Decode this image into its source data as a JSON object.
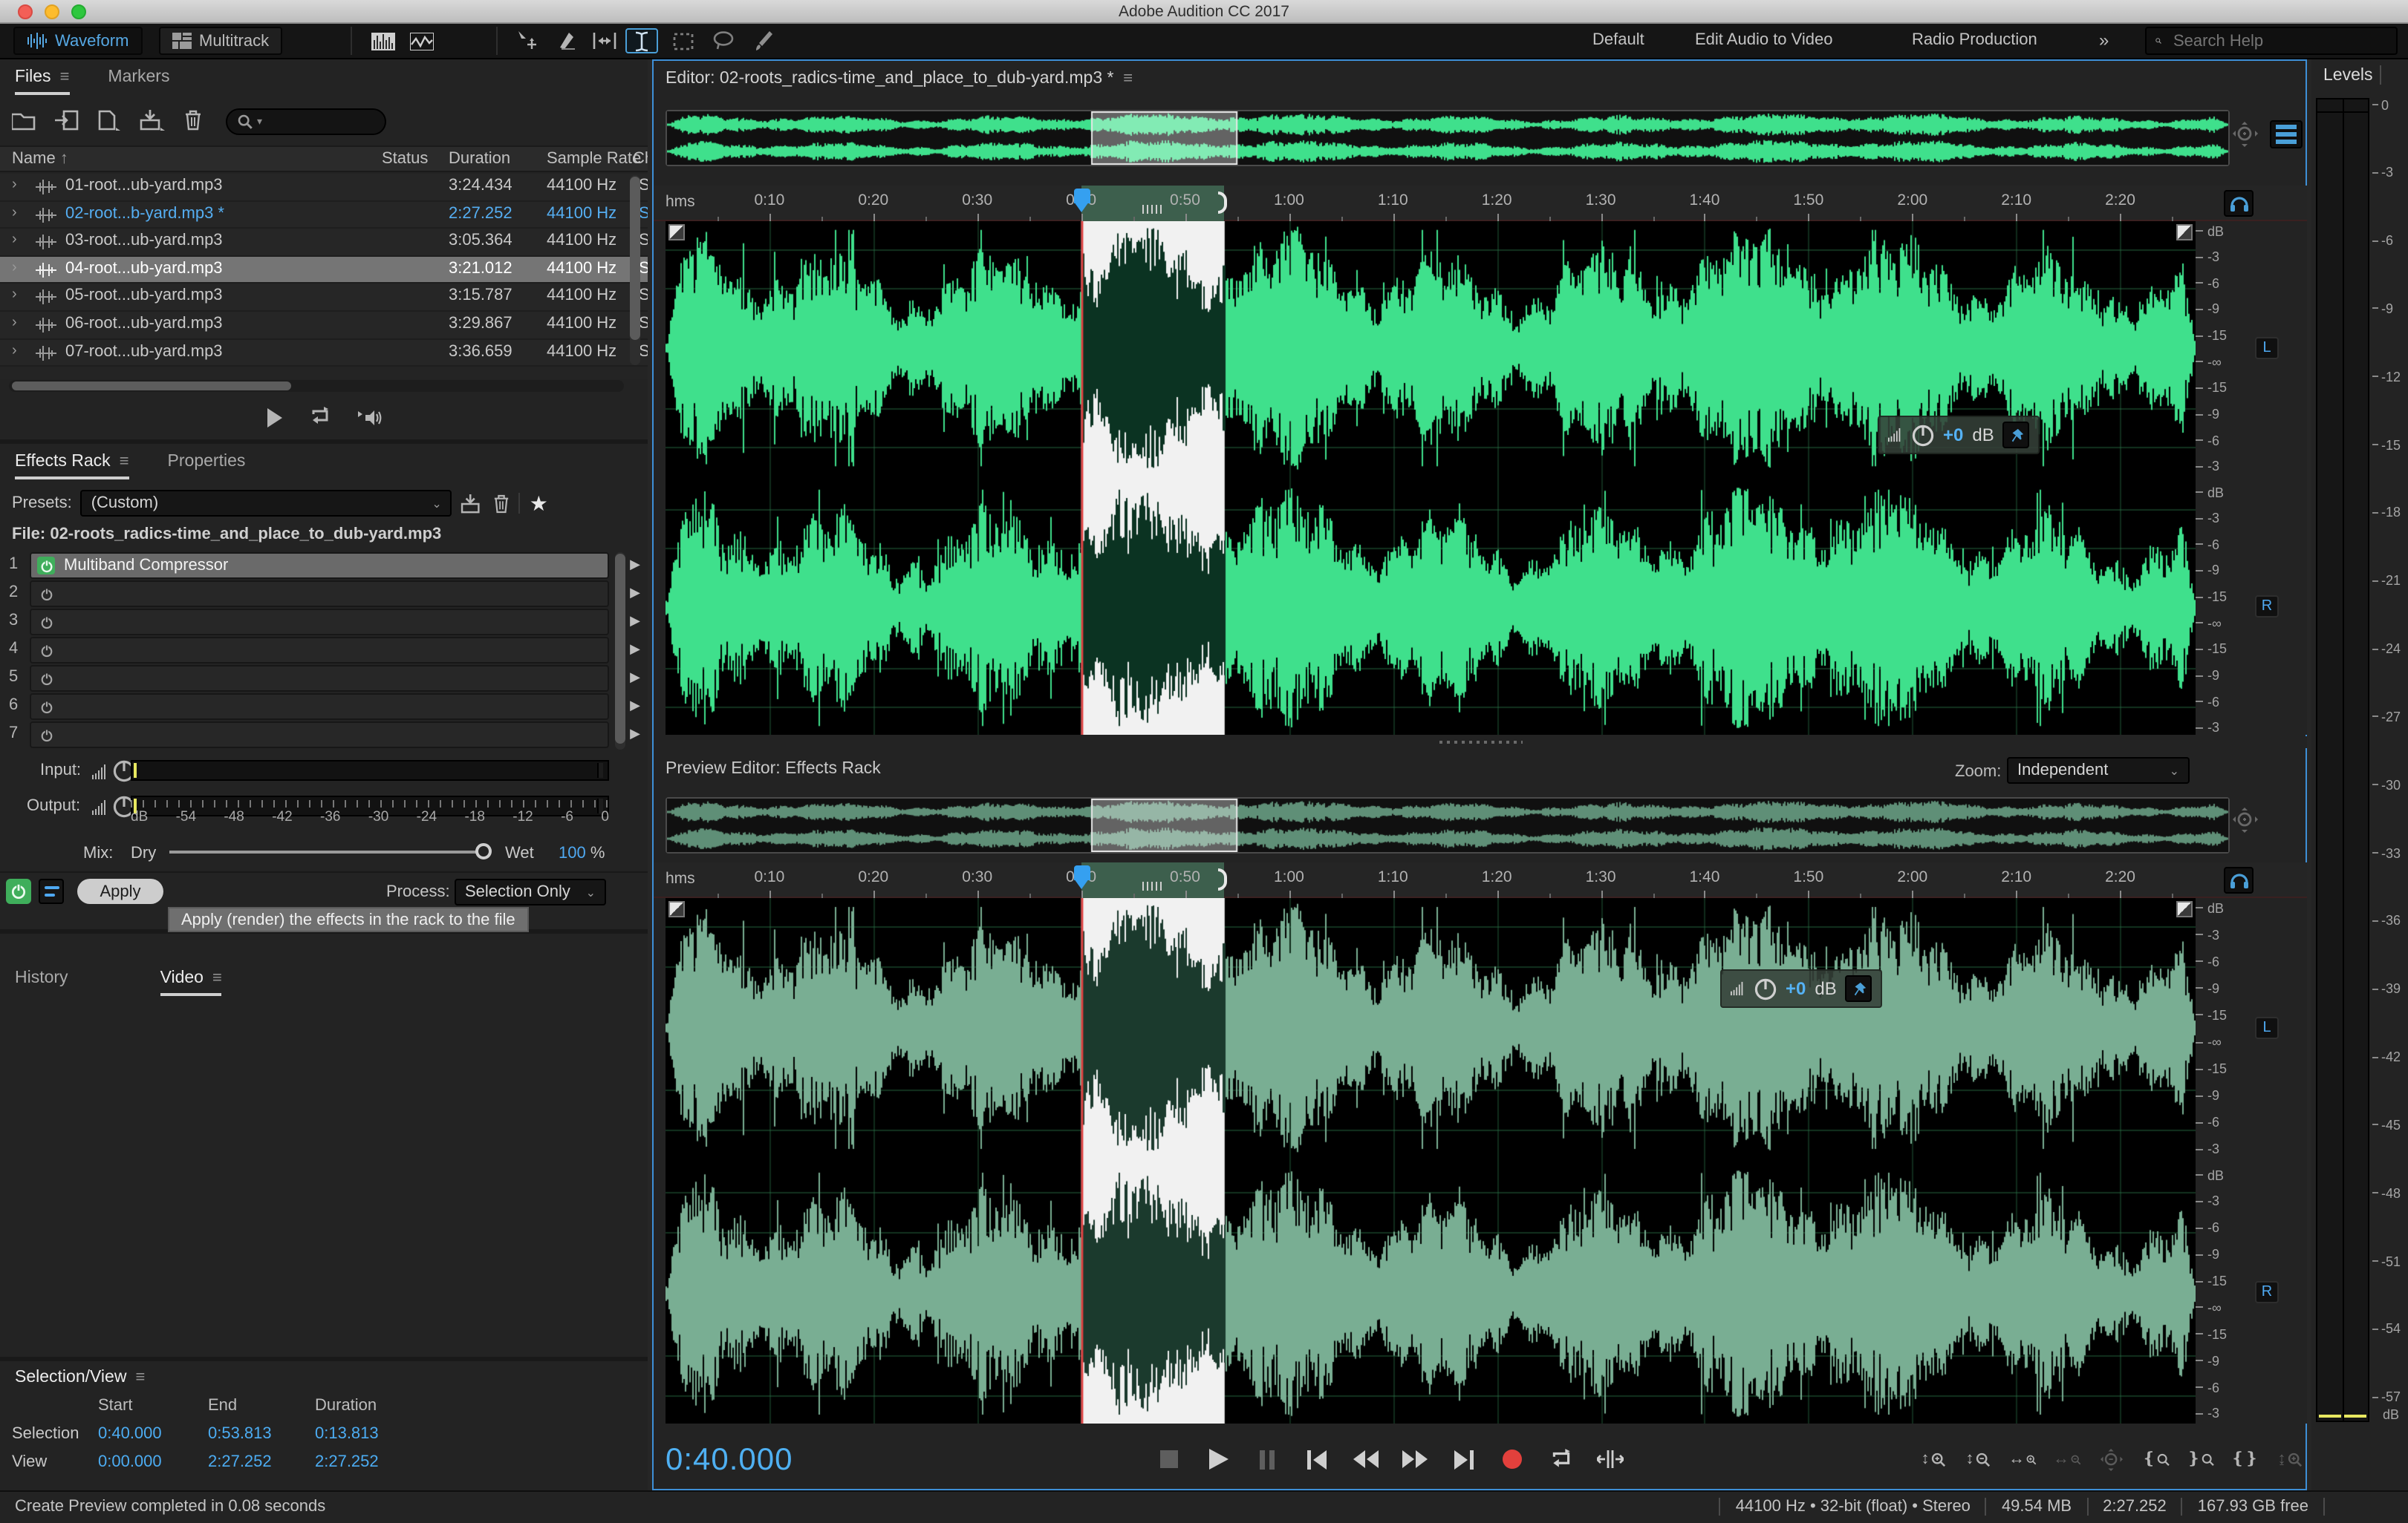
{
  "window": {
    "title": "Adobe Audition CC 2017"
  },
  "toolbar": {
    "waveform_btn": "Waveform",
    "multitrack_btn": "Multitrack",
    "workspaces": [
      "Default",
      "Edit Audio to Video",
      "Radio Production"
    ],
    "more_glyph": "»",
    "search": {
      "placeholder": "Search Help"
    }
  },
  "files_panel": {
    "tabs": [
      {
        "label": "Files"
      },
      {
        "label": "Markers"
      }
    ],
    "menu_glyph": "≡",
    "columns": {
      "name": "Name",
      "sort_arrow": "↑",
      "status": "Status",
      "duration": "Duration",
      "sample_rate": "Sample Rate",
      "channels": "Cha"
    },
    "rows": [
      {
        "name": "01-root...ub-yard.mp3",
        "status": "",
        "duration": "3:24.434",
        "sample_rate": "44100 Hz",
        "channels": "S"
      },
      {
        "name": "02-root...b-yard.mp3 *",
        "status": "",
        "duration": "2:27.252",
        "sample_rate": "44100 Hz",
        "channels": "S"
      },
      {
        "name": "03-root...ub-yard.mp3",
        "status": "",
        "duration": "3:05.364",
        "sample_rate": "44100 Hz",
        "channels": "S"
      },
      {
        "name": "04-root...ub-yard.mp3",
        "status": "",
        "duration": "3:21.012",
        "sample_rate": "44100 Hz",
        "channels": "S"
      },
      {
        "name": "05-root...ub-yard.mp3",
        "status": "",
        "duration": "3:15.787",
        "sample_rate": "44100 Hz",
        "channels": "S"
      },
      {
        "name": "06-root...ub-yard.mp3",
        "status": "",
        "duration": "3:29.867",
        "sample_rate": "44100 Hz",
        "channels": "S"
      },
      {
        "name": "07-root...ub-yard.mp3",
        "status": "",
        "duration": "3:36.659",
        "sample_rate": "44100 Hz",
        "channels": "S"
      }
    ],
    "open_row_index": 1,
    "selected_row_index": 3
  },
  "effects_rack": {
    "tabs": [
      {
        "label": "Effects Rack"
      },
      {
        "label": "Properties"
      }
    ],
    "presets_label": "Presets:",
    "preset_value": "(Custom)",
    "file_label": "File: 02-roots_radics-time_and_place_to_dub-yard.mp3",
    "slots": [
      {
        "n": "1",
        "name": "Multiband Compressor",
        "on": true
      },
      {
        "n": "2",
        "name": "",
        "on": false
      },
      {
        "n": "3",
        "name": "",
        "on": false
      },
      {
        "n": "4",
        "name": "",
        "on": false
      },
      {
        "n": "5",
        "name": "",
        "on": false
      },
      {
        "n": "6",
        "name": "",
        "on": false
      },
      {
        "n": "7",
        "name": "",
        "on": false
      }
    ],
    "input_label": "Input:",
    "output_label": "Output:",
    "gain_value": "+0",
    "meter_scale": [
      "dB",
      "-54",
      "-48",
      "-42",
      "-36",
      "-30",
      "-24",
      "-18",
      "-12",
      "-6",
      "0"
    ],
    "mix_label": "Mix:",
    "dry_label": "Dry",
    "wet_label": "Wet",
    "mix_value": "100",
    "mix_unit": "%",
    "apply_label": "Apply",
    "process_label": "Process:",
    "process_value": "Selection Only"
  },
  "tooltip": "Apply (render) the effects in the rack to the file",
  "history_panel": {
    "tabs": [
      {
        "label": "History"
      },
      {
        "label": "Video"
      }
    ]
  },
  "selection_view": {
    "title": "Selection/View",
    "columns": [
      "Start",
      "End",
      "Duration"
    ],
    "rows": [
      {
        "label": "Selection",
        "start": "0:40.000",
        "end": "0:53.813",
        "duration": "0:13.813"
      },
      {
        "label": "View",
        "start": "0:00.000",
        "end": "2:27.252",
        "duration": "2:27.252"
      }
    ]
  },
  "statusbar": {
    "left": "Create Preview completed in 0.08 seconds",
    "right": [
      "44100 Hz • 32-bit (float) • Stereo",
      "49.54 MB",
      "2:27.252",
      "167.93 GB free"
    ]
  },
  "editor": {
    "title": "Editor: 02-roots_radics-time_and_place_to_dub-yard.mp3 *",
    "menu_glyph": "≡",
    "ruler_unit": "hms",
    "ticks": [
      "0:10",
      "0:20",
      "0:30",
      "0:40",
      "0:50",
      "1:00",
      "1:10",
      "1:20",
      "1:30",
      "1:40",
      "1:50",
      "2:00",
      "2:10",
      "2:20"
    ],
    "duration_sec": 147.252,
    "selection_start_sec": 40.0,
    "selection_end_sec": 53.813,
    "db_scale": [
      "dB",
      "-3",
      "-6",
      "-9",
      "-15",
      "-∞",
      "-15",
      "-9",
      "-6",
      "-3"
    ],
    "channel_left": "L",
    "channel_right": "R",
    "hud": {
      "gain": "+0",
      "unit": "dB"
    },
    "time_display": "0:40.000"
  },
  "preview": {
    "title": "Preview Editor: Effects Rack",
    "zoom_label": "Zoom:",
    "zoom_value": "Independent"
  },
  "levels": {
    "title": "Levels",
    "scale": [
      "0",
      "-3",
      "-6",
      "-9",
      "-12",
      "-15",
      "-18",
      "-21",
      "-24",
      "-27",
      "-30",
      "-33",
      "-36",
      "-39",
      "-42",
      "-45",
      "-48",
      "-51",
      "-54",
      "-57"
    ],
    "unit": "dB"
  },
  "colors": {
    "accent_blue": "#4fa9f2",
    "wave_green": "#3fe08c",
    "wave_green_dim": "#79ae93",
    "record_red": "#e2403c",
    "power_green": "#3fae5b"
  }
}
